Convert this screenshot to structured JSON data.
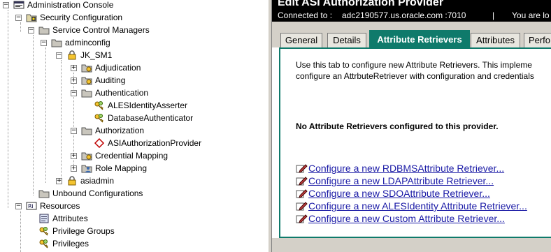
{
  "tree": {
    "nodes": [
      {
        "id": "admin-console",
        "label": "Administration Console",
        "toggle": "minus",
        "icon": "console",
        "level": 0
      },
      {
        "id": "security-configuration",
        "label": "Security Configuration",
        "toggle": "minus",
        "icon": "security-folder",
        "level": 1
      },
      {
        "id": "service-control-managers",
        "label": "Service Control Managers",
        "toggle": "minus",
        "icon": "folder",
        "level": 2
      },
      {
        "id": "adminconfig",
        "label": "adminconfig",
        "toggle": "minus",
        "icon": "folder",
        "level": 3
      },
      {
        "id": "jk-sm1",
        "label": "JK_SM1",
        "toggle": "minus",
        "icon": "lock",
        "level": 4
      },
      {
        "id": "adjudication",
        "label": "Adjudication",
        "toggle": "plus",
        "icon": "folder-provider",
        "level": 5
      },
      {
        "id": "auditing",
        "label": "Auditing",
        "toggle": "plus",
        "icon": "folder-provider",
        "level": 5
      },
      {
        "id": "authentication",
        "label": "Authentication",
        "toggle": "minus",
        "icon": "folder",
        "level": 5
      },
      {
        "id": "ales-identity-asserter",
        "label": "ALESIdentityAsserter",
        "toggle": "none",
        "icon": "keys",
        "level": 6
      },
      {
        "id": "database-authenticator",
        "label": "DatabaseAuthenticator",
        "toggle": "none",
        "icon": "keys",
        "level": 6
      },
      {
        "id": "authorization",
        "label": "Authorization",
        "toggle": "minus",
        "icon": "folder",
        "level": 5
      },
      {
        "id": "asi-authorization-provider",
        "label": "ASIAuthorizationProvider",
        "toggle": "none",
        "icon": "diamond",
        "level": 6
      },
      {
        "id": "credential-mapping",
        "label": "Credential Mapping",
        "toggle": "plus",
        "icon": "folder-provider",
        "level": 5
      },
      {
        "id": "role-mapping",
        "label": "Role Mapping",
        "toggle": "plus",
        "icon": "folder-role",
        "level": 5
      },
      {
        "id": "asiadmin",
        "label": "asiadmin",
        "toggle": "plus",
        "icon": "lock",
        "level": 4
      },
      {
        "id": "unbound-configurations",
        "label": "Unbound Configurations",
        "toggle": "none",
        "icon": "folder",
        "level": 3
      },
      {
        "id": "resources",
        "label": "Resources",
        "toggle": "minus",
        "icon": "resources",
        "level": 1
      },
      {
        "id": "attributes",
        "label": "Attributes",
        "toggle": "none",
        "icon": "attributes",
        "level": 2
      },
      {
        "id": "privilege-groups",
        "label": "Privilege Groups",
        "toggle": "none",
        "icon": "keys",
        "level": 2
      },
      {
        "id": "privileges",
        "label": "Privileges",
        "toggle": "none",
        "icon": "keys",
        "level": 2
      }
    ]
  },
  "panel": {
    "title": "Edit ASI Authorization Provider",
    "connected_label": "Connected to :",
    "connected_host": "adc2190577.us.oracle.com :7010",
    "separator": "|",
    "user_text": "You are lo",
    "tabs": [
      {
        "label": "General",
        "active": false
      },
      {
        "label": "Details",
        "active": false
      },
      {
        "label": "Attribute Retrievers",
        "active": true
      },
      {
        "label": "Attributes",
        "active": false
      },
      {
        "label": "Perfo",
        "active": false
      }
    ],
    "description_line1": "Use this tab to configure new Attribute Retrievers. This impleme",
    "description_line2": "configure an AttrbuteRetriever with configuration and credentials",
    "no_retrievers": "No Attribute Retrievers configured to this provider.",
    "links": [
      "Configure a new RDBMSAttribute Retriever...",
      "Configure a new LDAPAttribute Retriever...",
      "Configure a new SDOAttribute Retriever...",
      "Configure a new ALESIdentity Attribute Retriever...",
      "Configure a new Custom Attribute Retriever..."
    ]
  },
  "colors": {
    "accent": "#0f7a6b",
    "link": "#1a1aa6",
    "chrome": "#d4d0c8"
  }
}
